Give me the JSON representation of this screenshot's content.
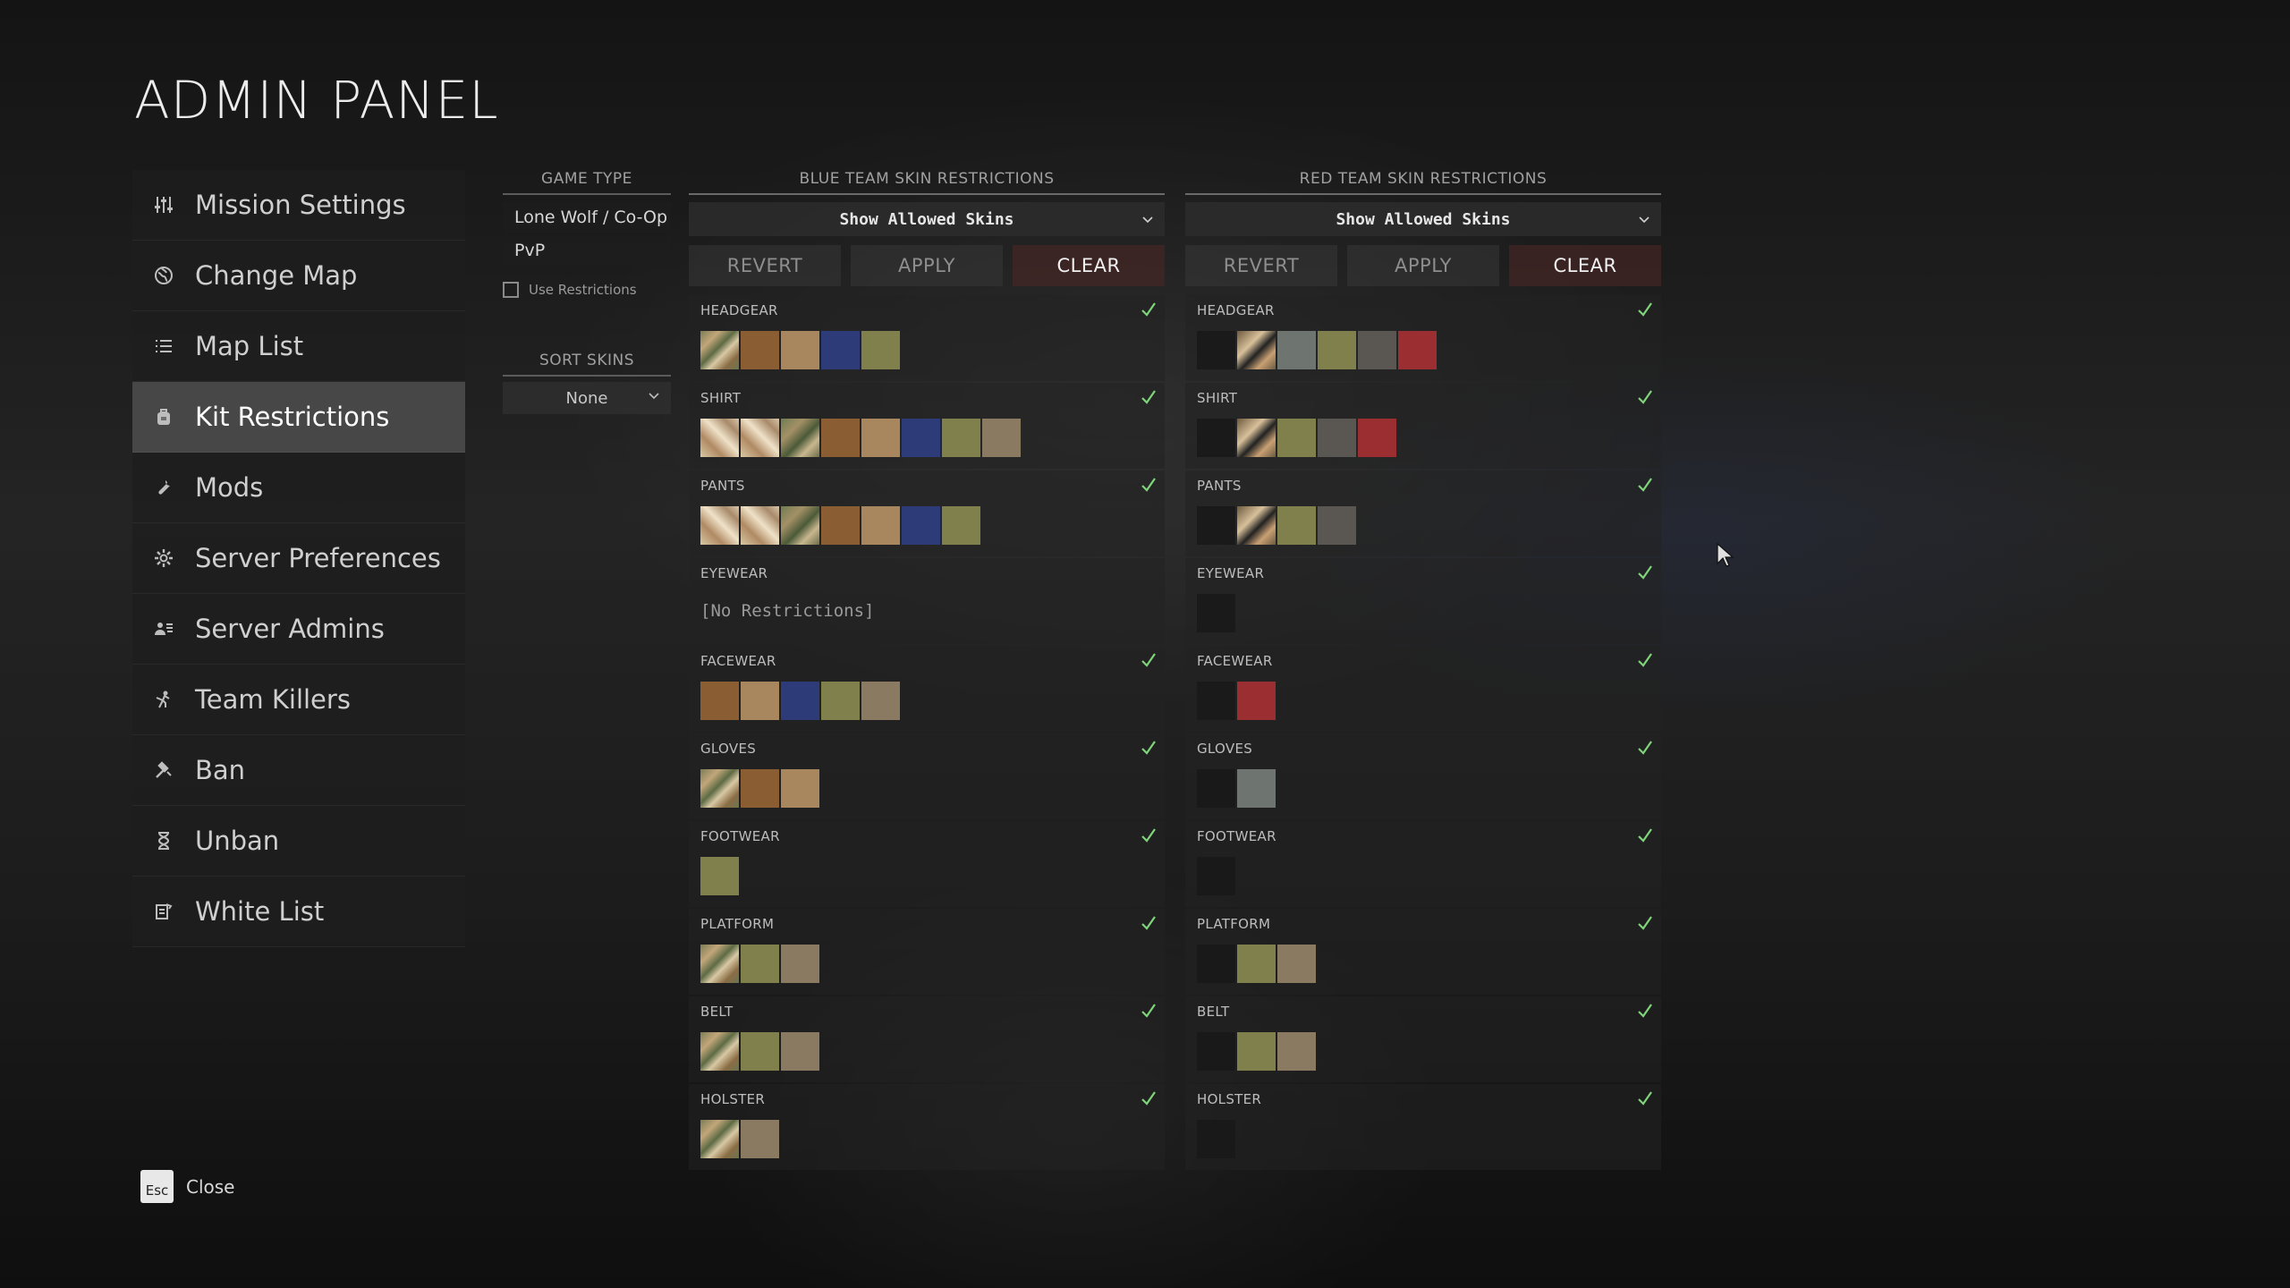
{
  "page": {
    "title": "ADMIN PANEL"
  },
  "sidebar": {
    "items": [
      {
        "label": "Mission Settings",
        "icon": "sliders-icon",
        "active": false
      },
      {
        "label": "Change Map",
        "icon": "globe-icon",
        "active": false
      },
      {
        "label": "Map List",
        "icon": "list-icon",
        "active": false
      },
      {
        "label": "Kit Restrictions",
        "icon": "backpack-icon",
        "active": true
      },
      {
        "label": "Mods",
        "icon": "wrench-icon",
        "active": false
      },
      {
        "label": "Server Preferences",
        "icon": "gear-icon",
        "active": false
      },
      {
        "label": "Server Admins",
        "icon": "admins-icon",
        "active": false
      },
      {
        "label": "Team Killers",
        "icon": "team-killer-icon",
        "active": false
      },
      {
        "label": "Ban",
        "icon": "ban-hammer-icon",
        "active": false
      },
      {
        "label": "Unban",
        "icon": "hourglass-icon",
        "active": false
      },
      {
        "label": "White List",
        "icon": "whitelist-icon",
        "active": false
      }
    ]
  },
  "game_type": {
    "header": "GAME TYPE",
    "options": [
      "Lone Wolf / Co-Op",
      "PvP"
    ],
    "use_restrictions_label": "Use Restrictions",
    "use_restrictions_checked": false
  },
  "sort_skins": {
    "header": "SORT SKINS",
    "value": "None"
  },
  "teams": {
    "blue": {
      "header": "BLUE TEAM SKIN RESTRICTIONS",
      "dropdown": "Show Allowed Skins",
      "buttons": {
        "revert": "REVERT",
        "apply": "APPLY",
        "clear": "CLEAR"
      },
      "slots": [
        {
          "label": "HEADGEAR",
          "checked": true,
          "swatches": [
            "multicam",
            "coyote",
            "tan",
            "navy",
            "olive"
          ]
        },
        {
          "label": "SHIRT",
          "checked": true,
          "swatches": [
            "desertcam",
            "desertcam",
            "woodland",
            "coyote",
            "tan",
            "navy",
            "olive",
            "khaki"
          ]
        },
        {
          "label": "PANTS",
          "checked": true,
          "swatches": [
            "desertcam",
            "desertcam",
            "woodland",
            "coyote",
            "tan",
            "navy",
            "olive"
          ]
        },
        {
          "label": "EYEWEAR",
          "checked": false,
          "swatches": [],
          "empty_text": "[No Restrictions]"
        },
        {
          "label": "FACEWEAR",
          "checked": true,
          "swatches": [
            "coyote",
            "tan",
            "navy",
            "olive",
            "khaki"
          ]
        },
        {
          "label": "GLOVES",
          "checked": true,
          "swatches": [
            "multicam",
            "coyote",
            "tan"
          ]
        },
        {
          "label": "FOOTWEAR",
          "checked": true,
          "swatches": [
            "olive"
          ]
        },
        {
          "label": "PLATFORM",
          "checked": true,
          "swatches": [
            "multicam",
            "olive",
            "khaki"
          ]
        },
        {
          "label": "BELT",
          "checked": true,
          "swatches": [
            "multicam",
            "olive",
            "khaki"
          ]
        },
        {
          "label": "HOLSTER",
          "checked": true,
          "swatches": [
            "multicam",
            "khaki"
          ]
        }
      ]
    },
    "red": {
      "header": "RED TEAM SKIN RESTRICTIONS",
      "dropdown": "Show Allowed Skins",
      "buttons": {
        "revert": "REVERT",
        "apply": "APPLY",
        "clear": "CLEAR"
      },
      "slots": [
        {
          "label": "HEADGEAR",
          "checked": true,
          "swatches": [
            "black",
            "cutout",
            "grey",
            "olive",
            "dkgrey",
            "red"
          ]
        },
        {
          "label": "SHIRT",
          "checked": true,
          "swatches": [
            "black",
            "cutout",
            "olive",
            "dkgrey",
            "red"
          ]
        },
        {
          "label": "PANTS",
          "checked": true,
          "swatches": [
            "black",
            "cutout",
            "olive",
            "dkgrey"
          ]
        },
        {
          "label": "EYEWEAR",
          "checked": true,
          "swatches": [
            "black"
          ]
        },
        {
          "label": "FACEWEAR",
          "checked": true,
          "swatches": [
            "black",
            "red"
          ]
        },
        {
          "label": "GLOVES",
          "checked": true,
          "swatches": [
            "dark2",
            "grey"
          ]
        },
        {
          "label": "FOOTWEAR",
          "checked": true,
          "swatches": [
            "dark2"
          ]
        },
        {
          "label": "PLATFORM",
          "checked": true,
          "swatches": [
            "dark2",
            "olive",
            "khaki"
          ]
        },
        {
          "label": "BELT",
          "checked": true,
          "swatches": [
            "dark2",
            "olive",
            "khaki"
          ]
        },
        {
          "label": "HOLSTER",
          "checked": true,
          "swatches": [
            "dark2"
          ]
        }
      ]
    }
  },
  "footer": {
    "esc_key": "Esc",
    "close_label": "Close"
  },
  "colors": {
    "check": "#7fd47a",
    "active_nav": "#6e6e6e",
    "clear_button": "#502826"
  }
}
